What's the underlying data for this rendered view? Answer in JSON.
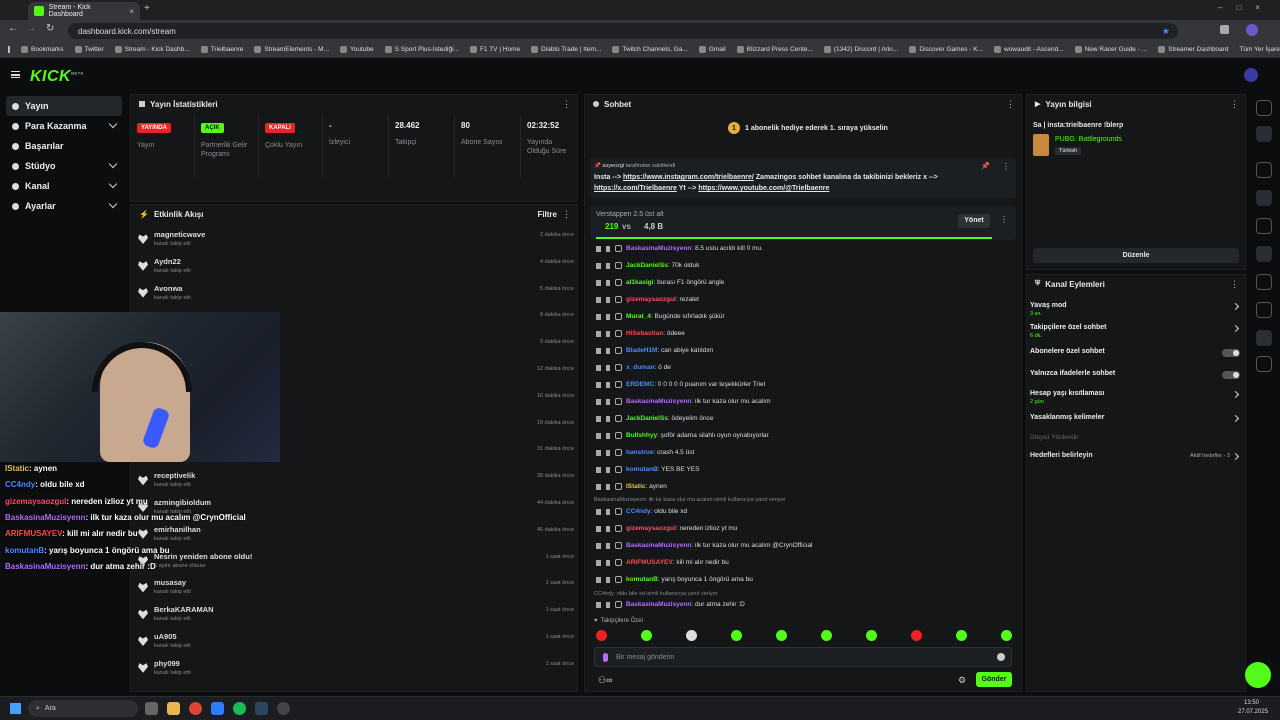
{
  "browser": {
    "tab_title": "Stream - Kick Dashboard",
    "url": "dashboard.kick.com/stream",
    "bookmarks": [
      "Bookmarks",
      "Twitter",
      "Stream - Kick Dashb...",
      "Trielbaenre",
      "StreamElements - M...",
      "Youtube",
      "S Sport Plus-İstediği...",
      "F1 TV | Home",
      "Diablo Trade | Item...",
      "Twitch Channels, Ga...",
      "Gmail",
      "Blizzard Press Cente...",
      "(1342) Discord | Arkı...",
      "Discover Games - K...",
      "wowaudit - Ascend...",
      "New Racer Guide - ...",
      "Streamer Dashboard"
    ],
    "all_bookmarks": "Tüm Yer İşaretleri"
  },
  "app": {
    "logo": "KICK",
    "logo_sup": "BETA"
  },
  "sidebar": {
    "items": [
      {
        "label": "Yayın"
      },
      {
        "label": "Para Kazanma"
      },
      {
        "label": "Başarılar"
      },
      {
        "label": "Stüdyo"
      },
      {
        "label": "Kanal"
      },
      {
        "label": "Ayarlar"
      }
    ]
  },
  "stats": {
    "title": "Yayın İstatistikleri",
    "items": [
      {
        "value": "YAYINDA",
        "label": "Yayın"
      },
      {
        "value": "AÇIK",
        "label": "Partnerlik Gelir Programı"
      },
      {
        "value": "KAPALI",
        "label": "Çoklu Yayın"
      },
      {
        "value": "-",
        "label": "İzleyici"
      },
      {
        "value": "28.462",
        "label": "Takipçi"
      },
      {
        "value": "80",
        "label": "Abone Sayısı"
      },
      {
        "value": "02:32:52",
        "label": "Yayında Olduğu Süre"
      }
    ]
  },
  "feed": {
    "title": "Etkinlik Akışı",
    "filter": "Filtre",
    "rows": [
      {
        "name": "magneticwave",
        "sub": "kanalı takip etti",
        "time": "2 dakika önce"
      },
      {
        "name": "Aydn22",
        "sub": "kanalı takip etti",
        "time": "4 dakika önce"
      },
      {
        "name": "Avonwa",
        "sub": "kanalı takip etti",
        "time": "5 dakika önce"
      },
      {
        "name": "",
        "sub": "",
        "time": "8 dakika önce"
      },
      {
        "name": "",
        "sub": "",
        "time": "9 dakika önce"
      },
      {
        "name": "",
        "sub": "",
        "time": "12 dakika önce"
      },
      {
        "name": "",
        "sub": "",
        "time": "16 dakika önce"
      },
      {
        "name": "",
        "sub": "",
        "time": "18 dakika önce"
      },
      {
        "name": "",
        "sub": "",
        "time": "31 dakika önce"
      },
      {
        "name": "receptivelik",
        "sub": "kanalı takip etti",
        "time": "38 dakika önce"
      },
      {
        "name": "azmingibioldum",
        "sub": "kanalı takip etti",
        "time": "44 dakika önce"
      },
      {
        "name": "emirhanilhan",
        "sub": "kanalı takip etti",
        "time": "46 dakika önce"
      },
      {
        "name": "Nesrin yeniden abone oldu!",
        "sub": "2 aydır abone oldular",
        "time": "1 saat önce"
      },
      {
        "name": "musasay",
        "sub": "kanalı takip etti",
        "time": "1 saat önce"
      },
      {
        "name": "BerkaKARAMAN",
        "sub": "kanalı takip etti",
        "time": "1 saat önce"
      },
      {
        "name": "uA905",
        "sub": "kanalı takip etti",
        "time": "1 saat önce"
      },
      {
        "name": "phy099",
        "sub": "kanalı takip etti",
        "time": "1 saat önce"
      }
    ]
  },
  "overlay": [
    {
      "user": "IStatic",
      "msg": ": aynen",
      "color": "#e6c04a"
    },
    {
      "user": "CC4ndy",
      "msg": ": oldu bile xd",
      "color": "#4a8cff"
    },
    {
      "user": "gizemaysaozgul",
      "msg": ": nereden izlioz yt mu",
      "color": "#ff4a6a"
    },
    {
      "user": "BaskasinaMuzisyenn",
      "msg": ": ilk tur kaza olur mu acalım @CrynOfficial",
      "color": "#b46cff"
    },
    {
      "user": "ARIFMUSAYEV",
      "msg": ": kill mi alır nedir bu",
      "color": "#ff4a4a"
    },
    {
      "user": "komutanB",
      "msg": ": yarış boyunca 1 öngörü ama bu",
      "color": "#4a8cff"
    },
    {
      "user": "BaskasinaMuzisyenn",
      "msg": ": dur atma zehir :D",
      "color": "#b46cff"
    }
  ],
  "chat": {
    "title": "Sohbet",
    "gift": "1 abonelik hediye ederek 1. sıraya yükselin",
    "gift_rank": "1",
    "pinned_by": "asyeozgi",
    "pinned_suffix": "tarafından sabitlendi",
    "pinned_pre": "Insta -->",
    "pinned_link1": "https://www.instagram.com/trielbaenre/",
    "pinned_mid": "Zamazingos sohbet kanalına da takibinizi bekleriz",
    "pinned_mid2": "x -->",
    "pinned_link2": "https://x.com/Trielbaenre",
    "pinned_mid3": "Yt -->",
    "pinned_link3": "https://www.youtube.com/@Trielbaenre",
    "prediction_title": "Verstappen 2.5 üst alt",
    "prediction_left": "219",
    "prediction_vs": "vs",
    "prediction_right": "4,8 B",
    "prediction_btn": "Yönet",
    "messages": [
      {
        "user": "BaskasinaMuzisyenn",
        "text": ": 8.5 ustu acıldı kill 0 mu.",
        "color": "#b46cff"
      },
      {
        "user": "JackDanielSs",
        "text": ": 70k olduk",
        "color": "#53fc18"
      },
      {
        "user": "al1kasigi",
        "text": ": burası F1 öngörü angle",
        "color": "#53fc18"
      },
      {
        "user": "gizemaysaozgul",
        "text": ": rezalet",
        "color": "#ff4a6a"
      },
      {
        "user": "Murat_4",
        "text": ": Bugünde sıfırladık şükür",
        "color": "#53fc18"
      },
      {
        "user": "HiSebastian",
        "text": ": ödeee",
        "color": "#ff4a4a"
      },
      {
        "user": "BladeH1M",
        "text": ": can abiye katıldım",
        "color": "#4a8cff"
      },
      {
        "user": "x_duman",
        "text": ": ö de",
        "color": "#4a8cff"
      },
      {
        "user": "ERDEMC",
        "text": ": 0 0 0 0 0 puanım var teşekkürler Triel",
        "color": "#4a8cff"
      },
      {
        "user": "BaskasinaMuzisyenn",
        "text": ": ilk tur kaza olur mu acalım",
        "color": "#b46cff"
      },
      {
        "user": "JackDanielSs",
        "text": ": ödeyelim önce",
        "color": "#53fc18"
      },
      {
        "user": "Bullshhyy",
        "text": ": şoför adama silahlı oyun oynabıyorlar",
        "color": "#53fc18"
      },
      {
        "user": "hanstrue",
        "text": ": crash 4.5 üst",
        "color": "#4a8cff"
      },
      {
        "user": "komutanB",
        "text": ": YES BE YES",
        "color": "#4a8cff"
      },
      {
        "user": "IStatic",
        "text": ": aynen",
        "color": "#e6c04a"
      }
    ],
    "reply1": "BaskasinaMuzisyenn: ilk tur kaza olur mu acalım isimli kullanıcıya yanıt veriyor",
    "messages2": [
      {
        "user": "CC4ndy",
        "text": ": oldu bile xd",
        "color": "#4a8cff"
      },
      {
        "user": "gizemaysaozgul",
        "text": ": nereden izlioz yt mu",
        "color": "#ff4a6a"
      },
      {
        "user": "BaskasinaMuzisyenn",
        "text": ": ilk tur kaza olur mu acalım @CrynOfficial",
        "color": "#b46cff"
      },
      {
        "user": "ARIFMUSAYEV",
        "text": ": kill mi alır nedir bu",
        "color": "#ff4a4a"
      },
      {
        "user": "komutanB",
        "text": ": yarış boyunca 1 öngörü ama bu",
        "color": "#53fc18"
      }
    ],
    "reply2": "CC4ndy: oldu bile xd isimli kullanıcıya yanıt veriyor",
    "last": {
      "user": "BaskasinaMuzisyenn",
      "text": ": dur atma zehir :D",
      "color": "#b46cff"
    },
    "followers_only": "Takipçilere Özel",
    "placeholder": "Bir mesaj gönderin",
    "send": "Gönder"
  },
  "stream_info": {
    "title": "Yayın bilgisi",
    "stream_title": "Sa | insta:trielbaenre !blerp",
    "category": "PUBG: Battlegrounds",
    "language": "Türkish",
    "edit": "Düzenle"
  },
  "channel_actions": {
    "title": "Kanal Eylemleri",
    "rows": [
      {
        "label": "Yavaş mod",
        "sub": "3 sn.",
        "kind": "arrow"
      },
      {
        "label": "Takipçilere özel sohbet",
        "sub": "6 dk.",
        "kind": "arrow"
      },
      {
        "label": "Abonelere özel sohbet",
        "sub": "",
        "kind": "toggle"
      },
      {
        "label": "Yalnızca ifadelerle sohbet",
        "sub": "",
        "kind": "toggle"
      },
      {
        "label": "Hesap yaşı kısıtlaması",
        "sub": "2 gün",
        "kind": "arrow"
      },
      {
        "label": "Yasaklanmış kelimeler",
        "sub": "",
        "kind": "arrow"
      }
    ],
    "viewer_direct": "İzleyici Yönlendir",
    "goals": "Hedefleri belirleyin",
    "goals_status": "Aktif hedefler - 2"
  },
  "taskbar": {
    "search": "Ara",
    "time": "13:50",
    "date": "27.07.2025"
  }
}
